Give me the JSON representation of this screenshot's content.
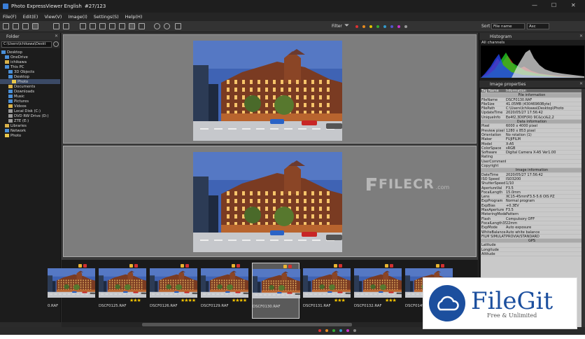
{
  "window": {
    "title": "Photo ExpressViewer English",
    "counter": "#27/123",
    "min": "—",
    "max": "☐",
    "close": "✕"
  },
  "menu": [
    "File(F)",
    "Edit(E)",
    "View(V)",
    "Image(I)",
    "Settings(S)",
    "Help(H)"
  ],
  "toolbar": {
    "filter_label": "Filter",
    "sort_label": "Sort",
    "sort_field": "File name",
    "sort_order": "Asc"
  },
  "filter_colors": [
    "#d33",
    "#e88a1e",
    "#e0c200",
    "#3a3",
    "#39c",
    "#55c",
    "#c3c",
    "#999"
  ],
  "folder_panel": {
    "title": "Folder",
    "path": "C:\\Users\\Ichikawa\\Deskt",
    "tree": [
      {
        "label": "Desktop",
        "level": 0,
        "icon": "#4a8fd8"
      },
      {
        "label": "OneDrive",
        "level": 1,
        "icon": "#4a8fd8"
      },
      {
        "label": "ichikawa",
        "level": 1,
        "icon": "#d9b24a"
      },
      {
        "label": "This PC",
        "level": 1,
        "icon": "#4a8fd8"
      },
      {
        "label": "3D Objects",
        "level": 2,
        "icon": "#4a8fd8"
      },
      {
        "label": "Desktop",
        "level": 2,
        "icon": "#4a8fd8"
      },
      {
        "label": "Photo",
        "level": 3,
        "icon": "#e8c84a",
        "selected": true
      },
      {
        "label": "Documents",
        "level": 2,
        "icon": "#d9b24a"
      },
      {
        "label": "Downloads",
        "level": 2,
        "icon": "#4a8fd8"
      },
      {
        "label": "Music",
        "level": 2,
        "icon": "#4a8fd8"
      },
      {
        "label": "Pictures",
        "level": 2,
        "icon": "#4a8fd8"
      },
      {
        "label": "Videos",
        "level": 2,
        "icon": "#d9b24a"
      },
      {
        "label": "Local Disk (C:)",
        "level": 2,
        "icon": "#999"
      },
      {
        "label": "DVD RW Drive (D:)",
        "level": 2,
        "icon": "#999"
      },
      {
        "label": "ZTE (E:)",
        "level": 2,
        "icon": "#999"
      },
      {
        "label": "Libraries",
        "level": 1,
        "icon": "#d9b24a"
      },
      {
        "label": "Network",
        "level": 1,
        "icon": "#4a8fd8"
      },
      {
        "label": "Photo",
        "level": 1,
        "icon": "#e8c84a"
      }
    ]
  },
  "histogram": {
    "title": "Histogram",
    "channel": "All channels"
  },
  "image_properties": {
    "title": "Image properties",
    "col_tag": "Tag Name",
    "col_info": "Information",
    "rows": [
      {
        "section": "File information"
      },
      {
        "k": "FileName",
        "v": "DSCF0130.RAF"
      },
      {
        "k": "FileSize",
        "v": "41.05MB (43046960Byte)"
      },
      {
        "k": "FilePath",
        "v": "C:\\Users\\Ichikawa\\Desktop\\Photo"
      },
      {
        "k": "UpdateTime",
        "v": "2020/05/27 17:56:42"
      },
      {
        "k": "UniqueInfo",
        "v": "Ee4f2,3D0F(RI) 9C&(x)&2,2"
      },
      {
        "section": "Data information"
      },
      {
        "k": "Pixel",
        "v": "6000 x 4000 pixel"
      },
      {
        "k": "Preview pixel",
        "v": "1280 x 853 pixel"
      },
      {
        "k": "Orientation",
        "v": "No rotation (1)"
      },
      {
        "k": "Maker",
        "v": "FUJIFILM"
      },
      {
        "k": "Model",
        "v": "X-A5"
      },
      {
        "k": "ColorSpace",
        "v": "sRGB"
      },
      {
        "k": "Software",
        "v": "Digital Camera X-A5 Ver1.00"
      },
      {
        "k": "Rating",
        "v": ""
      },
      {
        "k": "UserComment",
        "v": ""
      },
      {
        "k": "Copyright",
        "v": ""
      },
      {
        "section": "Image information"
      },
      {
        "k": "DateTime",
        "v": "2020/05/27 17:56:42"
      },
      {
        "k": "ISO Speed",
        "v": "ISO3200"
      },
      {
        "k": "ShutterSpeed",
        "v": "1/10"
      },
      {
        "k": "ApertureVal",
        "v": "F3.5"
      },
      {
        "k": "FocalLength",
        "v": "15.0mm"
      },
      {
        "k": "Lens",
        "v": "XC15-45mmF3.5-5.6 OIS PZ"
      },
      {
        "k": "ExpProgram",
        "v": "Normal program"
      },
      {
        "k": "ExpBias",
        "v": "+0.3EV"
      },
      {
        "k": "MaxAperture",
        "v": "F3.5"
      },
      {
        "k": "MeteringMode",
        "v": "Pattern"
      },
      {
        "k": "Flash",
        "v": "Compulsory OFF"
      },
      {
        "k": "FocalLength35",
        "v": "22mm"
      },
      {
        "k": "ExpMode",
        "v": "Auto exposure"
      },
      {
        "k": "WhiteBalance",
        "v": "Auto white balance"
      },
      {
        "k": "FILM SIMULATI",
        "v": "PROVIA/STANDARD"
      },
      {
        "section": "GPS"
      },
      {
        "k": "Latitude",
        "v": ""
      },
      {
        "k": "Longitude",
        "v": ""
      },
      {
        "k": "Altitude",
        "v": ""
      }
    ]
  },
  "filmstrip": [
    {
      "name": "0.RAF",
      "stars": "",
      "selected": false
    },
    {
      "name": "DSCF0125.RAF",
      "stars": "★★★",
      "selected": false
    },
    {
      "name": "DSCF0126.RAF",
      "stars": "★★★★",
      "selected": false
    },
    {
      "name": "DSCF0129.RAF",
      "stars": "★★★★",
      "selected": false
    },
    {
      "name": "DSCF0130.RAF",
      "stars": "",
      "selected": true
    },
    {
      "name": "DSCF0131.RAF",
      "stars": "★★★",
      "selected": false
    },
    {
      "name": "DSCF0132.RAF",
      "stars": "★★★",
      "selected": false
    },
    {
      "name": "DSCF0149.RAF",
      "stars": "★★★",
      "selected": false
    }
  ],
  "watermark": {
    "text": "FILECR",
    "suffix": ".com"
  },
  "brand": {
    "name": "FileGit",
    "tagline": "Free & Unlimited"
  }
}
